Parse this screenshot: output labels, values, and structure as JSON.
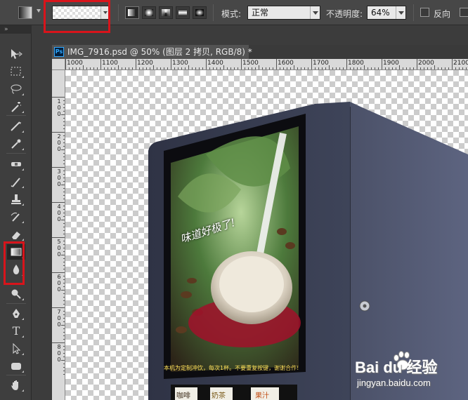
{
  "options_bar": {
    "mode_label": "模式:",
    "mode_value": "正常",
    "opacity_label": "不透明度:",
    "opacity_value": "64%",
    "reverse_label": "反向",
    "gradient_types": [
      "linear-gradient-icon",
      "radial-gradient-icon",
      "angle-gradient-icon",
      "reflected-gradient-icon",
      "diamond-gradient-icon"
    ],
    "active_gradient_type": "linear-gradient-icon"
  },
  "document": {
    "tab_title": "IMG_7916.psd @ 50% (图层 2 拷贝, RGB/8) *",
    "app_badge": "Ps"
  },
  "rulers": {
    "top": [
      "1000",
      "1100",
      "1200",
      "1300",
      "1400",
      "1500",
      "1600",
      "1700",
      "1800",
      "1900",
      "2000",
      "2100"
    ],
    "left": [
      "100",
      "200",
      "300",
      "400",
      "500",
      "600",
      "700",
      "800"
    ]
  },
  "canvas": {
    "poster_text": "味道好极了!",
    "screen_footer": "本机为定制冲饮，每次1杯。不要重复按键，谢谢合作!",
    "products": [
      "咖啡",
      "奶茶",
      "果汁"
    ]
  },
  "watermark": {
    "brand": "Bai du 经验",
    "url": "jingyan.baidu.com"
  },
  "colors": {
    "highlight": "#d8141b",
    "panel": "#474747",
    "canvas_bg": "#ffffff"
  },
  "tools": [
    "move-tool",
    "marquee-tool",
    "lasso-tool",
    "magic-wand-tool",
    "crop-tool",
    "eyedropper-tool",
    "healing-brush-tool",
    "brush-tool",
    "clone-stamp-tool",
    "history-brush-tool",
    "eraser-tool",
    "gradient-tool",
    "blur-tool",
    "dodge-tool",
    "pen-tool",
    "type-tool",
    "path-selection-tool",
    "shape-tool",
    "hand-tool"
  ],
  "active_tool": "gradient-tool"
}
